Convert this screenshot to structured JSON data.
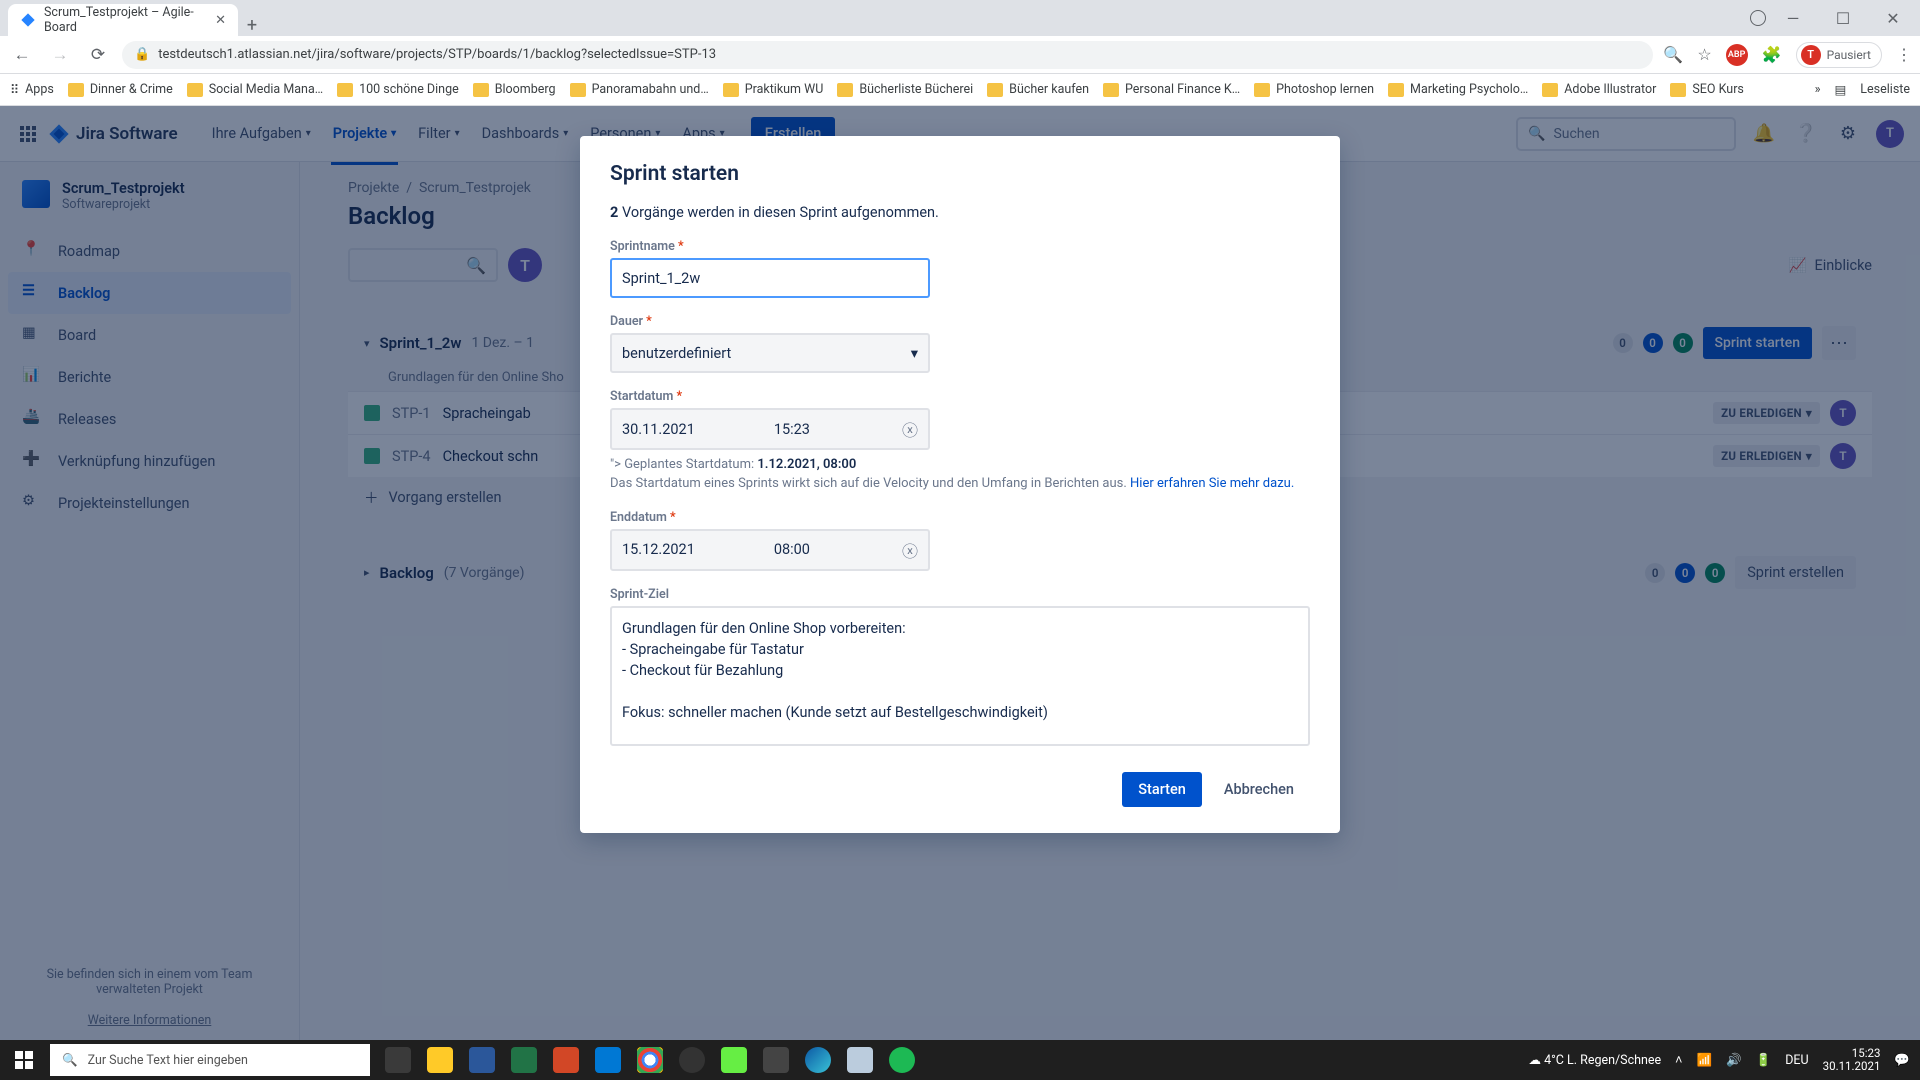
{
  "browser": {
    "tab_title": "Scrum_Testprojekt – Agile-Board",
    "url": "testdeutsch1.atlassian.net/jira/software/projects/STP/boards/1/backlog?selectedIssue=STP-13",
    "paused": "Pausiert",
    "apps_label": "Apps",
    "bookmarks": [
      "Dinner & Crime",
      "Social Media Mana…",
      "100 schöne Dinge",
      "Bloomberg",
      "Panoramabahn und…",
      "Praktikum WU",
      "Bücherliste Bücherei",
      "Bücher kaufen",
      "Personal Finance K…",
      "Photoshop lernen",
      "Marketing Psycholo…",
      "Adobe Illustrator",
      "SEO Kurs"
    ],
    "reading_list": "Leseliste"
  },
  "jira_nav": {
    "product": "Jira Software",
    "items": [
      "Ihre Aufgaben",
      "Projekte",
      "Filter",
      "Dashboards",
      "Personen",
      "Apps"
    ],
    "active_index": 1,
    "create": "Erstellen",
    "search_placeholder": "Suchen",
    "avatar": "T"
  },
  "sidebar": {
    "project_name": "Scrum_Testprojekt",
    "project_type": "Softwareprojekt",
    "items": [
      {
        "label": "Roadmap"
      },
      {
        "label": "Backlog"
      },
      {
        "label": "Board"
      },
      {
        "label": "Berichte"
      },
      {
        "label": "Releases"
      },
      {
        "label": "Verknüpfung hinzufügen"
      },
      {
        "label": "Projekteinstellungen"
      }
    ],
    "active_index": 1,
    "footer_line": "Sie befinden sich in einem vom Team verwalteten Projekt",
    "footer_link": "Weitere Informationen"
  },
  "page": {
    "crumb_projects": "Projekte",
    "crumb_project": "Scrum_Testprojek",
    "title": "Backlog",
    "insights": "Einblicke"
  },
  "sprint_panel": {
    "name": "Sprint_1_2w",
    "dates": "1 Dez. – 1",
    "subtitle": "Grundlagen für den Online Sho",
    "counts": {
      "grey": "0",
      "blue": "0",
      "green": "0"
    },
    "start_label": "Sprint starten",
    "issues": [
      {
        "key": "STP-1",
        "summary": "Spracheingab",
        "status": "ZU ERLEDIGEN"
      },
      {
        "key": "STP-4",
        "summary": "Checkout schn",
        "status": "ZU ERLEDIGEN"
      }
    ],
    "create_issue": "Vorgang erstellen"
  },
  "backlog_panel": {
    "title": "Backlog",
    "count_label": "(7 Vorgänge)",
    "counts": {
      "grey": "0",
      "blue": "0",
      "green": "0"
    },
    "create_sprint": "Sprint erstellen"
  },
  "modal": {
    "title": "Sprint starten",
    "count": "2",
    "count_suffix": "Vorgänge werden in diesen Sprint aufgenommen.",
    "labels": {
      "name": "Sprintname",
      "duration": "Dauer",
      "start": "Startdatum",
      "end": "Enddatum",
      "goal": "Sprint-Ziel"
    },
    "values": {
      "name": "Sprint_1_2w",
      "duration": "benutzerdefiniert",
      "start_date": "30.11.2021",
      "start_time": "15:23",
      "end_date": "15.12.2021",
      "end_time": "08:00",
      "goal": "Grundlagen für den Online Shop vorbereiten:\n- Spracheingabe für Tastatur\n- Checkout für Bezahlung\n\nFokus: schneller machen (Kunde setzt auf Bestellgeschwindigkeit)"
    },
    "help_planned_prefix": "Geplantes Startdatum: ",
    "help_planned_value": "1.12.2021, 08:00",
    "help_velocity": "Das Startdatum eines Sprints wirkt sich auf die Velocity und den Umfang in Berichten aus. ",
    "help_link": "Hier erfahren Sie mehr dazu.",
    "actions": {
      "primary": "Starten",
      "secondary": "Abbrechen"
    }
  },
  "taskbar": {
    "search_placeholder": "Zur Suche Text hier eingeben",
    "weather": "4°C  L. Regen/Schnee",
    "lang": "DEU",
    "time": "15:23",
    "date": "30.11.2021"
  }
}
